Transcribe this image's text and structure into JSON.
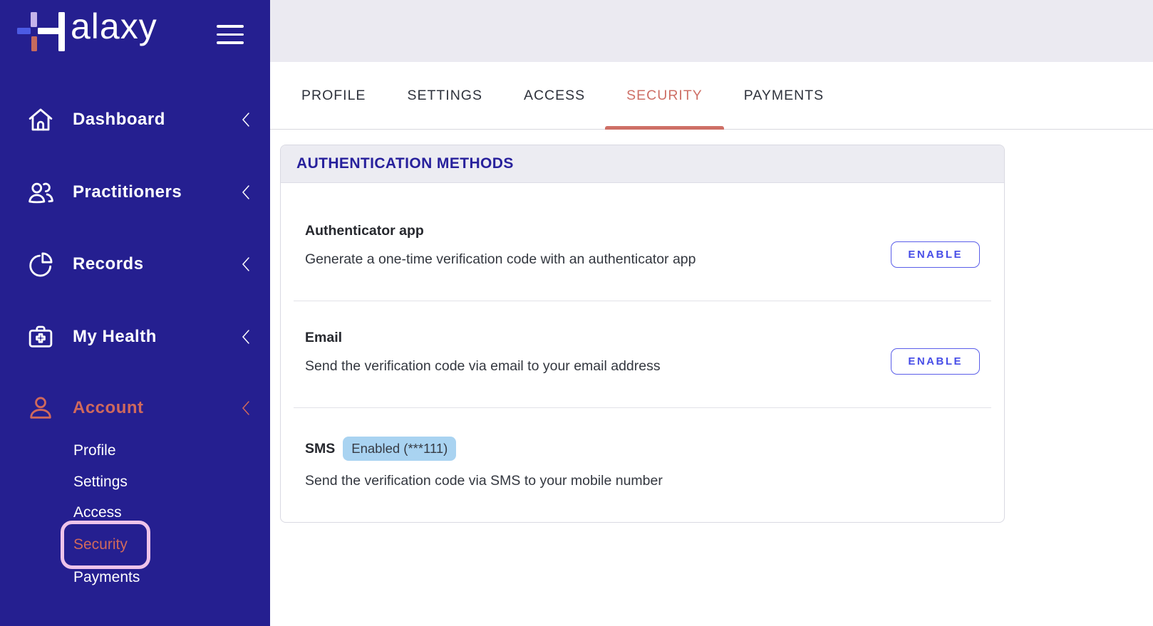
{
  "brand": {
    "name": "Halaxy",
    "wordmark_visible": "alaxy"
  },
  "sidebar": {
    "items": [
      {
        "label": "Dashboard",
        "icon": "home-icon"
      },
      {
        "label": "Practitioners",
        "icon": "people-icon"
      },
      {
        "label": "Records",
        "icon": "pie-chart-icon"
      },
      {
        "label": "My Health",
        "icon": "medical-bag-icon"
      },
      {
        "label": "Account",
        "icon": "person-icon",
        "active": true
      }
    ],
    "account_submenu": [
      {
        "label": "Profile"
      },
      {
        "label": "Settings"
      },
      {
        "label": "Access"
      },
      {
        "label": "Security",
        "active": true,
        "highlighted": true
      },
      {
        "label": "Payments"
      }
    ]
  },
  "tabs": {
    "items": [
      {
        "label": "PROFILE"
      },
      {
        "label": "SETTINGS"
      },
      {
        "label": "ACCESS"
      },
      {
        "label": "SECURITY",
        "active": true
      },
      {
        "label": "PAYMENTS"
      }
    ]
  },
  "panel": {
    "title": "AUTHENTICATION METHODS",
    "methods": [
      {
        "name": "Authenticator app",
        "description": "Generate a one-time verification code with an authenticator app",
        "action_label": "ENABLE"
      },
      {
        "name": "Email",
        "description": "Send the verification code via email to your email address",
        "action_label": "ENABLE"
      },
      {
        "name": "SMS",
        "status_badge": "Enabled (***111)",
        "description": "Send the verification code via SMS to your mobile number"
      }
    ]
  },
  "colors": {
    "sidebar_bg": "#251f90",
    "accent_coral": "#cf6e63",
    "brand_indigo": "#28219c",
    "enable_blue": "#4a4fe8",
    "badge_bg": "#a9d3f1",
    "highlight_ring": "#eec3ea",
    "topstrip_bg": "#ebeaf1",
    "panel_header_bg": "#ececf2"
  }
}
